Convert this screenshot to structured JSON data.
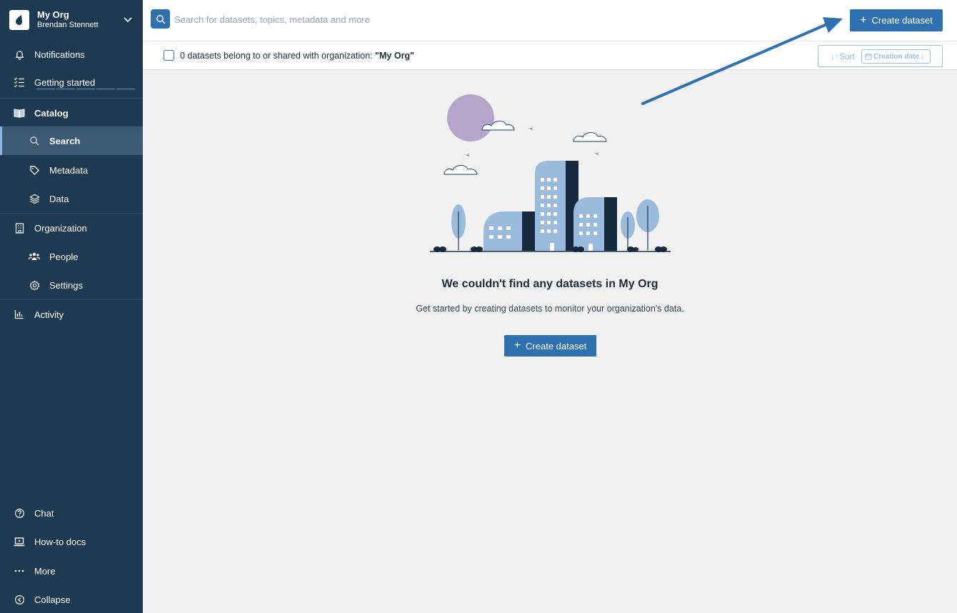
{
  "org": {
    "name": "My Org",
    "user": "Brendan Stennett"
  },
  "nav": {
    "notifications": "Notifications",
    "getting_started": "Getting started",
    "catalog": "Catalog",
    "search": "Search",
    "metadata": "Metadata",
    "data": "Data",
    "organization": "Organization",
    "people": "People",
    "settings": "Settings",
    "activity": "Activity",
    "chat": "Chat",
    "howto": "How-to docs",
    "more": "More",
    "collapse": "Collapse"
  },
  "search": {
    "placeholder": "Search for datasets, topics, metadata and more"
  },
  "header": {
    "create_label": "Create dataset"
  },
  "filter": {
    "text_prefix": "0 datasets belong to or shared with organization: ",
    "org_quoted": "\"My Org\"",
    "sort_label": "Sort",
    "sort_field": "Creation date"
  },
  "empty": {
    "title": "We couldn't find any datasets in My Org",
    "subtitle": "Get started by creating datasets to monitor your organization's data.",
    "create_label": "Create dataset"
  },
  "colors": {
    "sidebar": "#1e3a52",
    "accent": "#2f70b1",
    "building_light": "#9bbbdc",
    "building_dark": "#152a3e",
    "sun": "#b4a6cb"
  }
}
